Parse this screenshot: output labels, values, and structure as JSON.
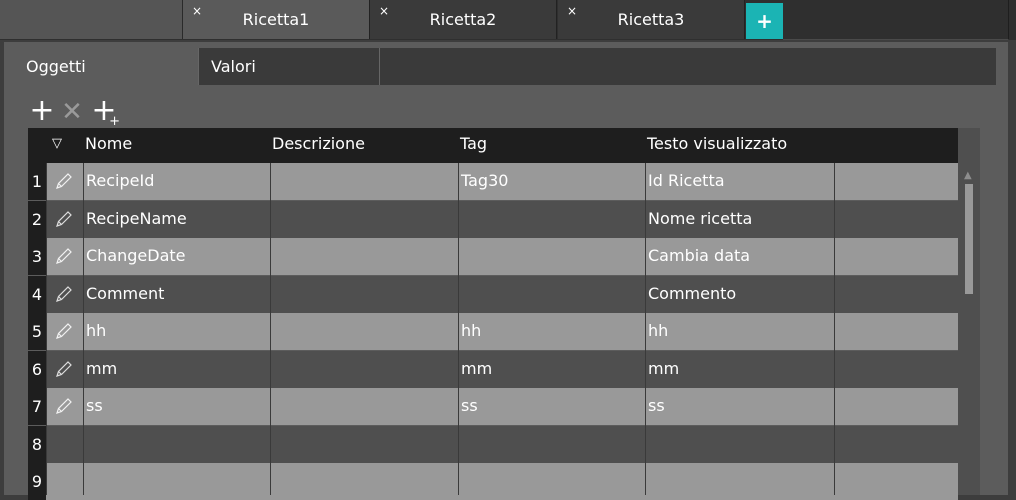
{
  "tabs": [
    {
      "label": "Ricetta1",
      "close": "×",
      "active": true
    },
    {
      "label": "Ricetta2",
      "close": "×",
      "active": false
    },
    {
      "label": "Ricetta3",
      "close": "×",
      "active": false
    }
  ],
  "add_tab": {
    "label": "+"
  },
  "subtabs": {
    "objects": "Oggetti",
    "values": "Valori"
  },
  "toolbar": {
    "add_icon": "+",
    "delete_icon": "✕",
    "insert_icon": "+",
    "insert_badge": "+"
  },
  "grid": {
    "filter_icon": "▽",
    "headers": {
      "name": "Nome",
      "description": "Descrizione",
      "tag": "Tag",
      "display_text": "Testo visualizzato"
    },
    "rows": [
      {
        "num": "1",
        "name": "RecipeId",
        "description": "",
        "tag": "Tag30",
        "display_text": "Id Ricetta"
      },
      {
        "num": "2",
        "name": "RecipeName",
        "description": "",
        "tag": "",
        "display_text": "Nome ricetta"
      },
      {
        "num": "3",
        "name": "ChangeDate",
        "description": "",
        "tag": "",
        "display_text": "Cambia data"
      },
      {
        "num": "4",
        "name": "Comment",
        "description": "",
        "tag": "",
        "display_text": "Commento"
      },
      {
        "num": "5",
        "name": "hh",
        "description": "",
        "tag": "hh",
        "display_text": "hh"
      },
      {
        "num": "6",
        "name": "mm",
        "description": "",
        "tag": "mm",
        "display_text": "mm"
      },
      {
        "num": "7",
        "name": "ss",
        "description": "",
        "tag": "ss",
        "display_text": "ss"
      },
      {
        "num": "8",
        "name": "",
        "description": "",
        "tag": "",
        "display_text": ""
      },
      {
        "num": "9",
        "name": "",
        "description": "",
        "tag": "",
        "display_text": ""
      }
    ]
  },
  "colors": {
    "accent": "#1bb4b4",
    "header_bg": "#1e1e1e",
    "row_light": "#999999",
    "row_dark": "#4f4f4f"
  }
}
